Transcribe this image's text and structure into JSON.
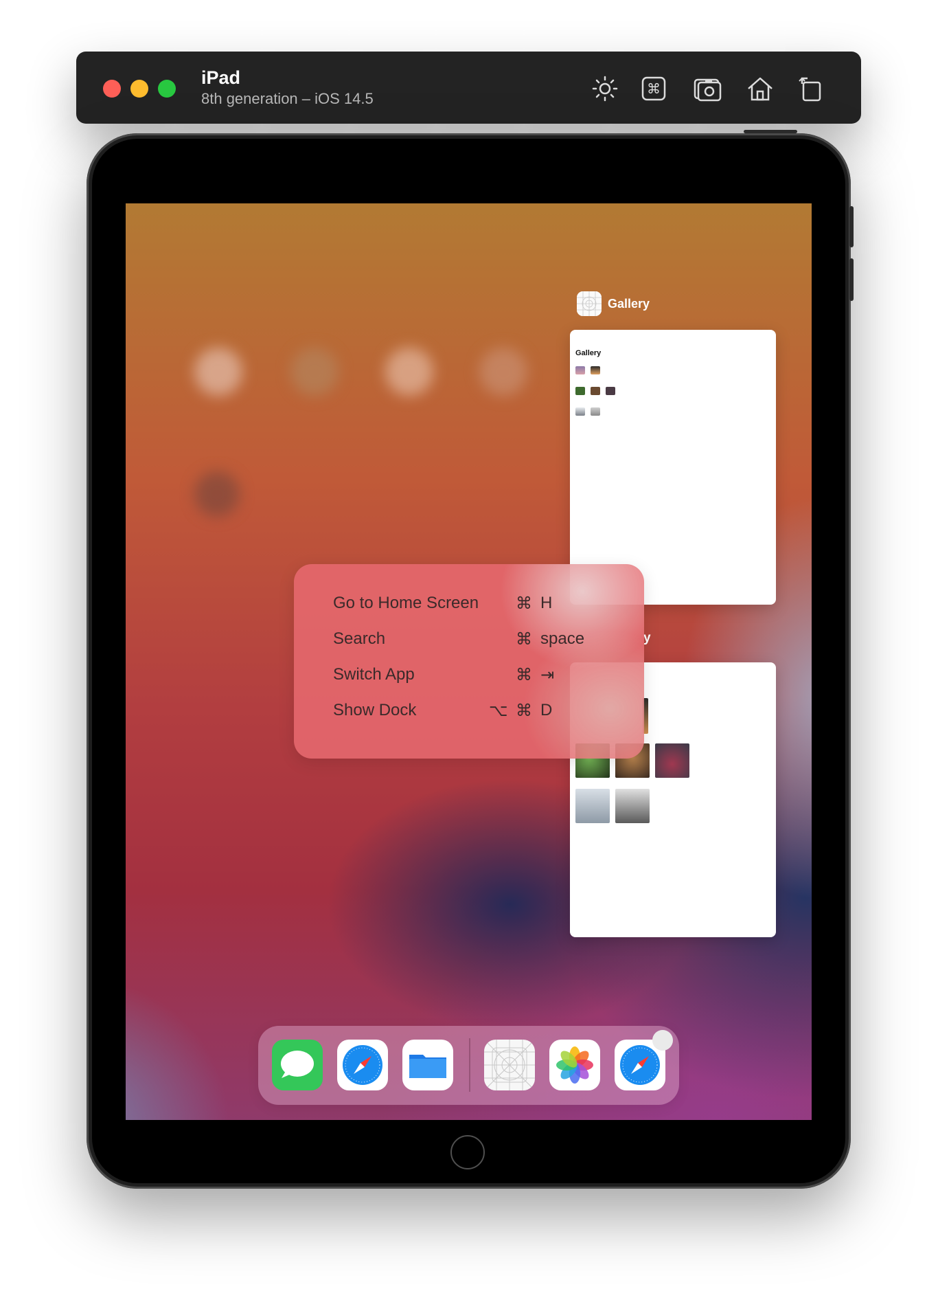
{
  "window": {
    "title": "iPad",
    "subtitle": "8th generation – iOS 14.5",
    "toolbar_icons": [
      "brightness-icon",
      "command-icon",
      "screenshot-camera-icon",
      "home-icon",
      "rotate-icon"
    ]
  },
  "app_switcher": {
    "app_name": "Gallery",
    "card1": {
      "title": "Gallery"
    },
    "card2_partial_label": "y"
  },
  "shortcuts_hud": {
    "rows": [
      {
        "label": "Go to Home Screen",
        "keys": [
          "⌘",
          "H"
        ]
      },
      {
        "label": "Search",
        "keys": [
          "⌘",
          "space"
        ]
      },
      {
        "label": "Switch App",
        "keys": [
          "⌘",
          "⇥"
        ]
      },
      {
        "label": "Show Dock",
        "keys": [
          "⌥",
          "⌘",
          "D"
        ]
      }
    ]
  },
  "dock": {
    "apps": [
      "messages-icon",
      "safari-icon",
      "files-icon",
      "gallery-app-icon",
      "photos-icon",
      "safari-icon"
    ]
  },
  "colors": {
    "toolbar_bg": "#232323",
    "close": "#fe5f57",
    "minimize": "#febc2e",
    "zoom": "#28c840"
  }
}
